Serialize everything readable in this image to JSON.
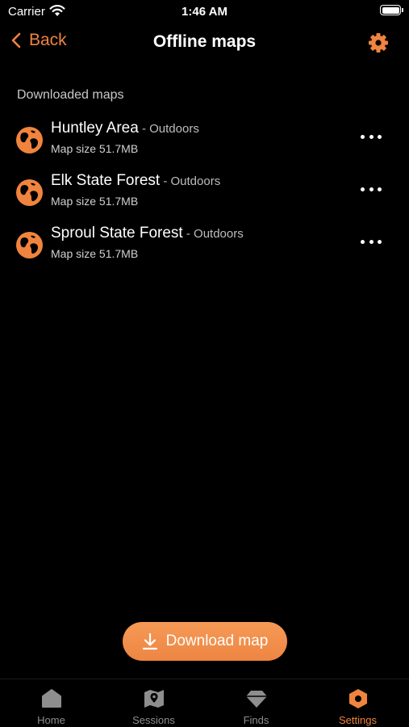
{
  "status_bar": {
    "carrier": "Carrier",
    "time": "1:46 AM"
  },
  "nav": {
    "back_label": "Back",
    "title": "Offline maps"
  },
  "section_title": "Downloaded maps",
  "maps": [
    {
      "name": "Huntley Area",
      "category": " - Outdoors",
      "size": "Map size 51.7MB"
    },
    {
      "name": "Elk State Forest",
      "category": " - Outdoors",
      "size": "Map size 51.7MB"
    },
    {
      "name": "Sproul State Forest",
      "category": " - Outdoors",
      "size": "Map size 51.7MB"
    }
  ],
  "download_button": {
    "label": "Download map"
  },
  "tabs": [
    {
      "label": "Home",
      "icon": "home-icon"
    },
    {
      "label": "Sessions",
      "icon": "map-icon"
    },
    {
      "label": "Finds",
      "icon": "diamond-icon"
    },
    {
      "label": "Settings",
      "icon": "hexagon-settings-icon",
      "active": true
    }
  ],
  "colors": {
    "accent": "#f0843e",
    "background": "#000000",
    "inactive_tab": "#8e8e8e"
  }
}
